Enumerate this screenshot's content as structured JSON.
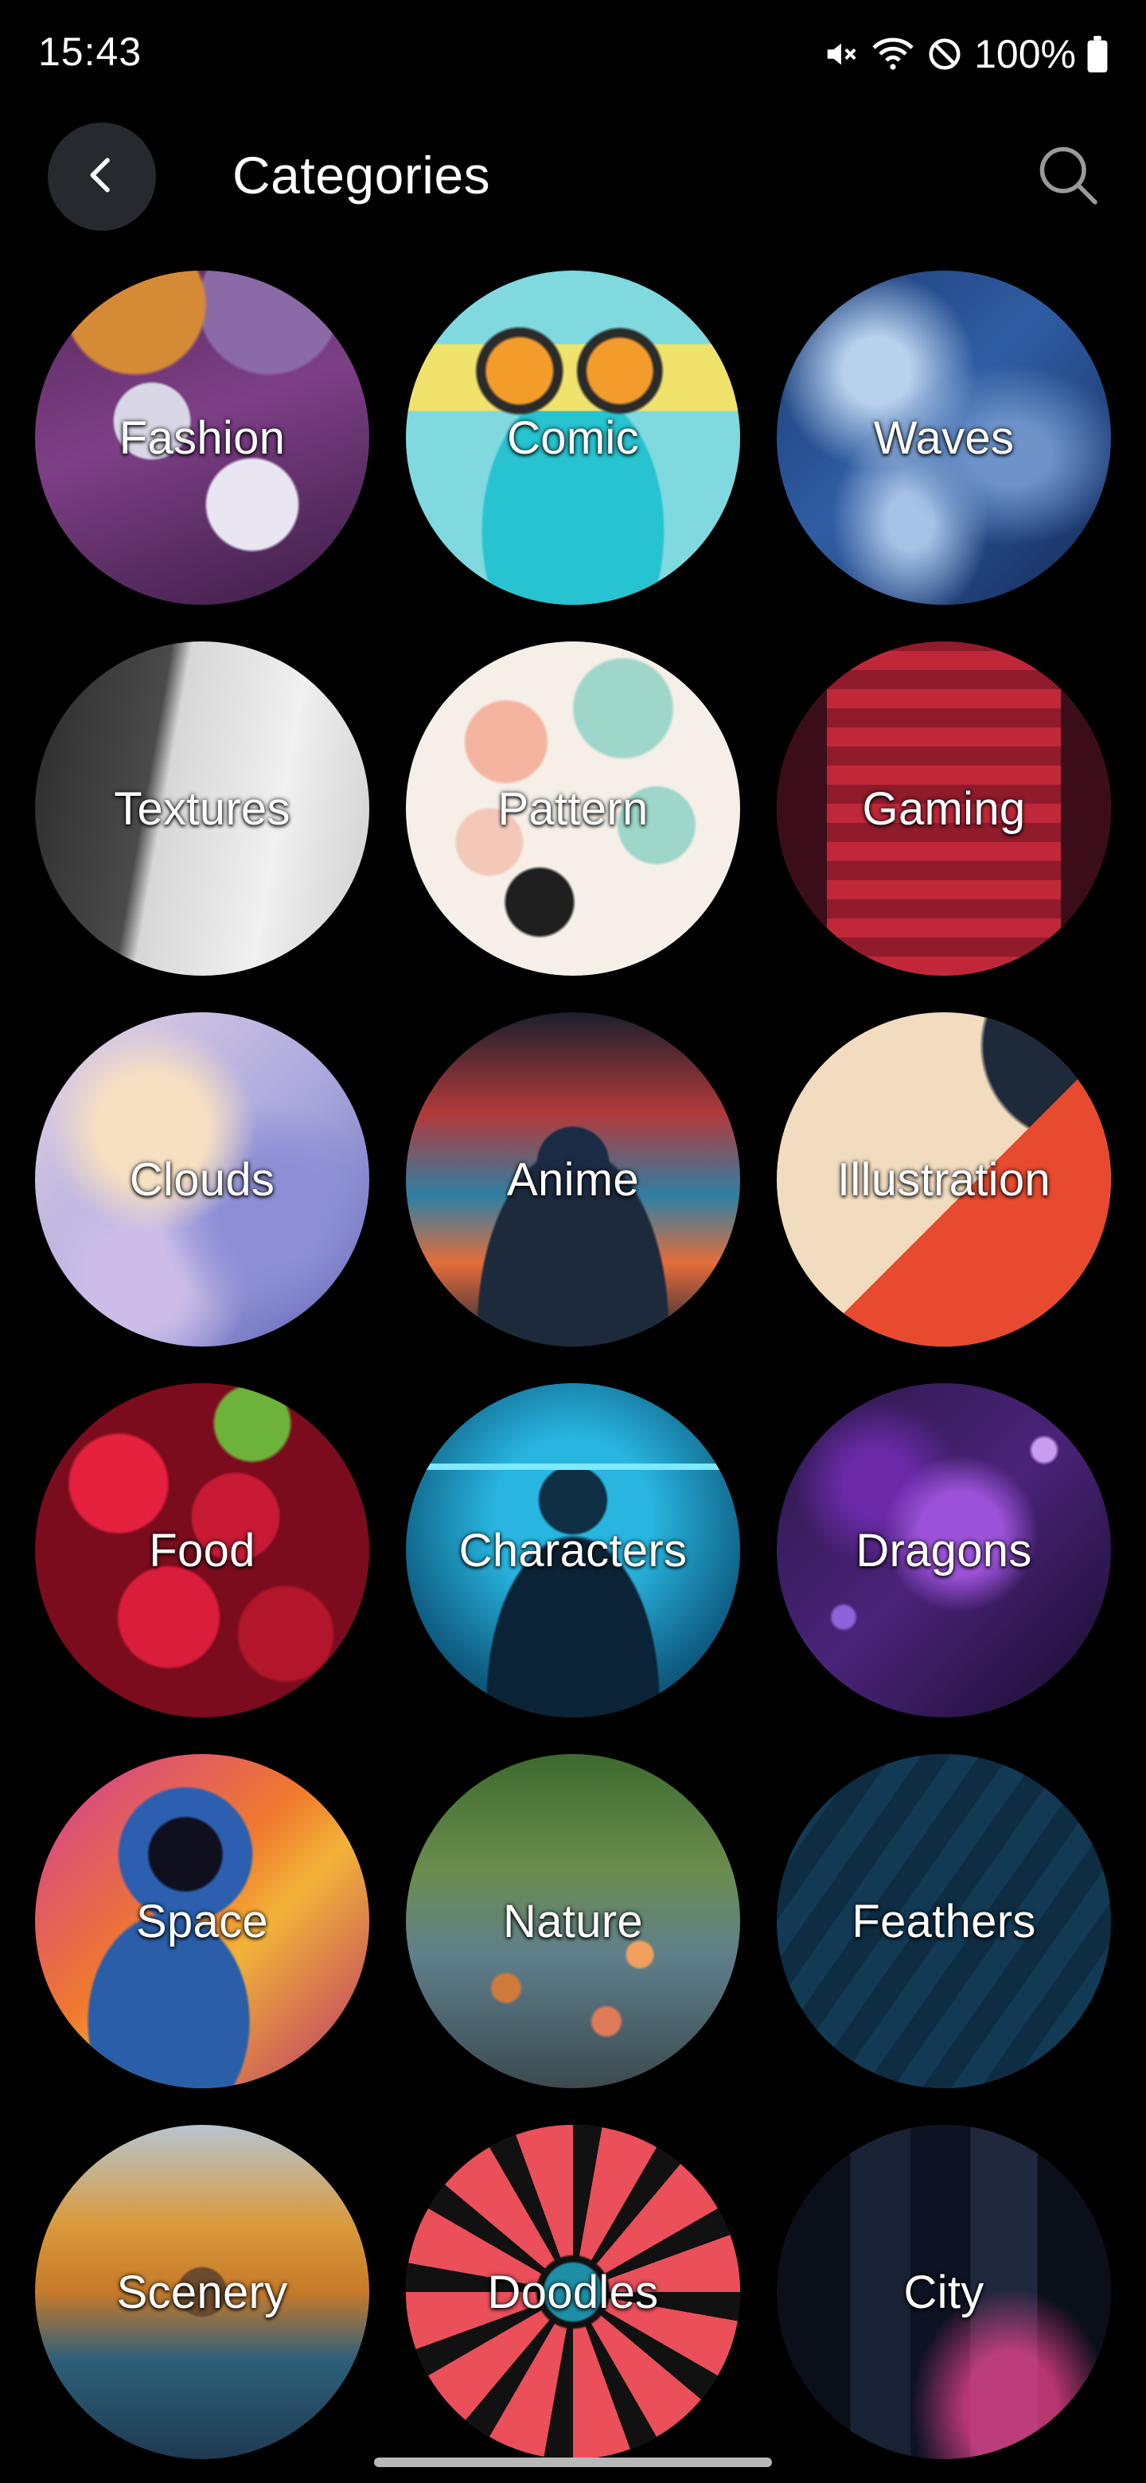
{
  "status_bar": {
    "time": "15:43",
    "battery": "100%",
    "icons": [
      "mute-icon",
      "wifi-icon",
      "do-not-disturb-icon",
      "battery-icon"
    ]
  },
  "app_bar": {
    "title": "Categories",
    "back_icon": "chevron-left-icon",
    "search_icon": "search-icon"
  },
  "categories": [
    {
      "label": "Fashion"
    },
    {
      "label": "Comic"
    },
    {
      "label": "Waves"
    },
    {
      "label": "Textures"
    },
    {
      "label": "Pattern"
    },
    {
      "label": "Gaming"
    },
    {
      "label": "Clouds"
    },
    {
      "label": "Anime"
    },
    {
      "label": "Illustration"
    },
    {
      "label": "Food"
    },
    {
      "label": "Characters"
    },
    {
      "label": "Dragons"
    },
    {
      "label": "Space"
    },
    {
      "label": "Nature"
    },
    {
      "label": "Feathers"
    },
    {
      "label": "Scenery"
    },
    {
      "label": "Doodles"
    },
    {
      "label": "City"
    }
  ],
  "colors": {
    "background": "#000000",
    "back_button_bg": "#262a2f",
    "text": "#ffffff"
  }
}
